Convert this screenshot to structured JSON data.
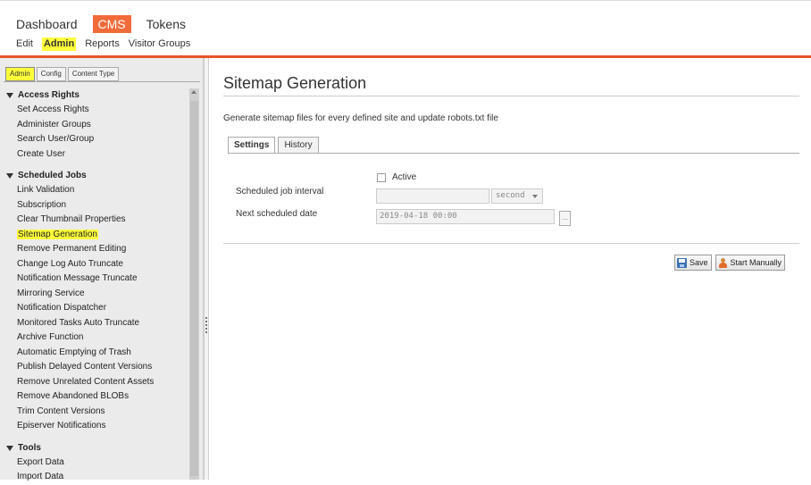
{
  "main_nav": {
    "items": [
      "Dashboard",
      "CMS",
      "Tokens"
    ],
    "active": "CMS"
  },
  "sub_nav": {
    "items": [
      "Edit",
      "Admin",
      "Reports",
      "Visitor Groups"
    ],
    "active": "Admin"
  },
  "left_panel": {
    "tabs": [
      "Admin",
      "Config",
      "Content Type"
    ],
    "groups": [
      {
        "title": "Access Rights",
        "items": [
          "Set Access Rights",
          "Administer Groups",
          "Search User/Group",
          "Create User"
        ]
      },
      {
        "title": "Scheduled Jobs",
        "items": [
          "Link Validation",
          "Subscription",
          "Clear Thumbnail Properties",
          "Sitemap Generation",
          "Remove Permanent Editing",
          "Change Log Auto Truncate",
          "Notification Message Truncate",
          "Mirroring Service",
          "Notification Dispatcher",
          "Monitored Tasks Auto Truncate",
          "Archive Function",
          "Automatic Emptying of Trash",
          "Publish Delayed Content Versions",
          "Remove Unrelated Content Assets",
          "Remove Abandoned BLOBs",
          "Trim Content Versions",
          "Episerver Notifications"
        ]
      },
      {
        "title": "Tools",
        "items": [
          "Export Data",
          "Import Data"
        ]
      }
    ],
    "selected_item": "Sitemap Generation"
  },
  "main": {
    "title": "Sitemap Generation",
    "description": "Generate sitemap files for every defined site and update robots.txt file",
    "tabs": [
      "Settings",
      "History"
    ],
    "active_tab": "Settings",
    "form": {
      "active_label": "Active",
      "active_checked": false,
      "interval_label": "Scheduled job interval",
      "interval_value": "",
      "interval_unit": "second",
      "next_date_label": "Next scheduled date",
      "next_date_value": "2019-04-18 00:00",
      "picker_label": "..."
    },
    "buttons": {
      "save": "Save",
      "start": "Start Manually"
    }
  },
  "colors": {
    "accent": "#f26b3a",
    "accent_line": "#e8542a",
    "highlight": "#ffff3b"
  }
}
